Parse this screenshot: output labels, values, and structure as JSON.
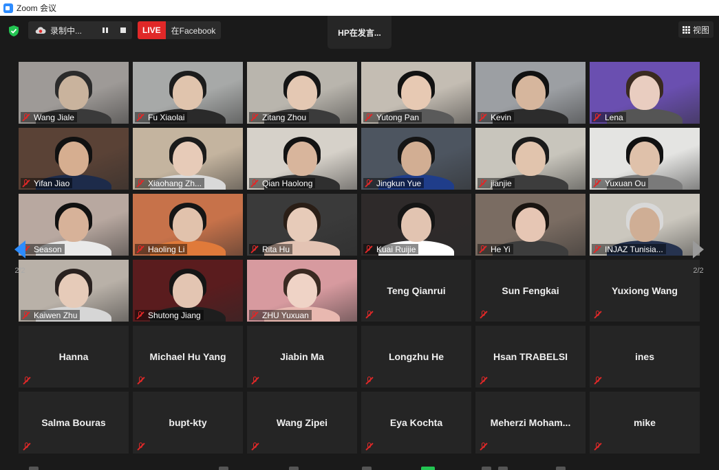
{
  "window": {
    "title": "Zoom 会议"
  },
  "topbar": {
    "recording_label": "录制中...",
    "live_badge": "LIVE",
    "live_target": "在Facebook",
    "speaker_label": "HP在发言...",
    "view_label": "视图"
  },
  "navigation": {
    "page_left": "2/2",
    "page_right": "2/2"
  },
  "colors": {
    "accent": "#2d8cff",
    "live_red": "#e02828",
    "mute_red": "#e02828",
    "shield_green": "#23c552"
  },
  "participants": [
    {
      "name": "Wang Jiale",
      "video": true
    },
    {
      "name": "Fu Xiaolai",
      "video": true
    },
    {
      "name": "Zitang Zhou",
      "video": true
    },
    {
      "name": "Yutong Pan",
      "video": true
    },
    {
      "name": "Kevin",
      "video": true
    },
    {
      "name": "Lena",
      "video": true
    },
    {
      "name": "Yifan Jiao",
      "video": true
    },
    {
      "name": "Xiaohang Zh...",
      "video": true
    },
    {
      "name": "Qian Haolong",
      "video": true
    },
    {
      "name": "Jingkun Yue",
      "video": true
    },
    {
      "name": "jianjie",
      "video": true
    },
    {
      "name": "Yuxuan Ou",
      "video": true
    },
    {
      "name": "Season",
      "video": true
    },
    {
      "name": "Haoling Li",
      "video": true
    },
    {
      "name": "Rita Hu",
      "video": true
    },
    {
      "name": "Kuai Ruijie",
      "video": true
    },
    {
      "name": "He Yi",
      "video": true
    },
    {
      "name": "INJAZ Tunisia...",
      "video": true
    },
    {
      "name": "Kaiwen Zhu",
      "video": true
    },
    {
      "name": "Shutong Jiang",
      "video": true
    },
    {
      "name": "ZHU Yuxuan",
      "video": true
    },
    {
      "name": "Teng Qianrui",
      "video": false
    },
    {
      "name": "Sun Fengkai",
      "video": false
    },
    {
      "name": "Yuxiong Wang",
      "video": false
    },
    {
      "name": "Hanna",
      "video": false
    },
    {
      "name": "Michael Hu Yang",
      "video": false
    },
    {
      "name": "Jiabin  Ma",
      "video": false
    },
    {
      "name": "Longzhu He",
      "video": false
    },
    {
      "name": "Hsan TRABELSI",
      "video": false
    },
    {
      "name": "ines",
      "video": false
    },
    {
      "name": "Salma Bouras",
      "video": false
    },
    {
      "name": "bupt-kty",
      "video": false
    },
    {
      "name": "Wang Zipei",
      "video": false
    },
    {
      "name": "Eya Kochta",
      "video": false
    },
    {
      "name": "Meherzi  Moham...",
      "video": false
    },
    {
      "name": "mike",
      "video": false
    }
  ]
}
